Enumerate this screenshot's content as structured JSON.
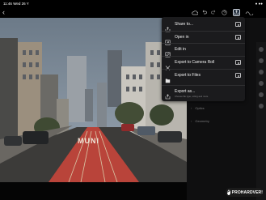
{
  "status_bar": {
    "time": "11:46",
    "date": "Wed 26 Y",
    "right_text": "● ●●"
  },
  "toolbar": {
    "back": "‹",
    "icons": [
      "cloud-icon",
      "undo-icon",
      "redo-icon",
      "help-icon",
      "share-icon",
      "more-icon"
    ]
  },
  "share_menu": {
    "items": [
      {
        "label": "Share to...",
        "icon": "share-to-icon",
        "badge": true
      },
      {
        "label": "Open in",
        "icon": "open-in-icon",
        "badge": true
      },
      {
        "label": "Edit in",
        "icon": "edit-in-icon",
        "badge": false
      },
      {
        "label": "Export to Camera Roll",
        "icon": "camera-roll-icon",
        "badge": true
      },
      {
        "label": "Export to Files",
        "icon": "folder-icon",
        "badge": true
      },
      {
        "label": "Export as...",
        "sub": "Choose file type, sizing and more",
        "icon": "export-as-icon",
        "badge": false
      }
    ]
  },
  "panel": {
    "rows": [
      "Optics",
      "Geometry"
    ]
  },
  "photo": {
    "road_text": "MUNI"
  },
  "watermark": {
    "logo": "P",
    "text": "PROHARDVER!"
  }
}
